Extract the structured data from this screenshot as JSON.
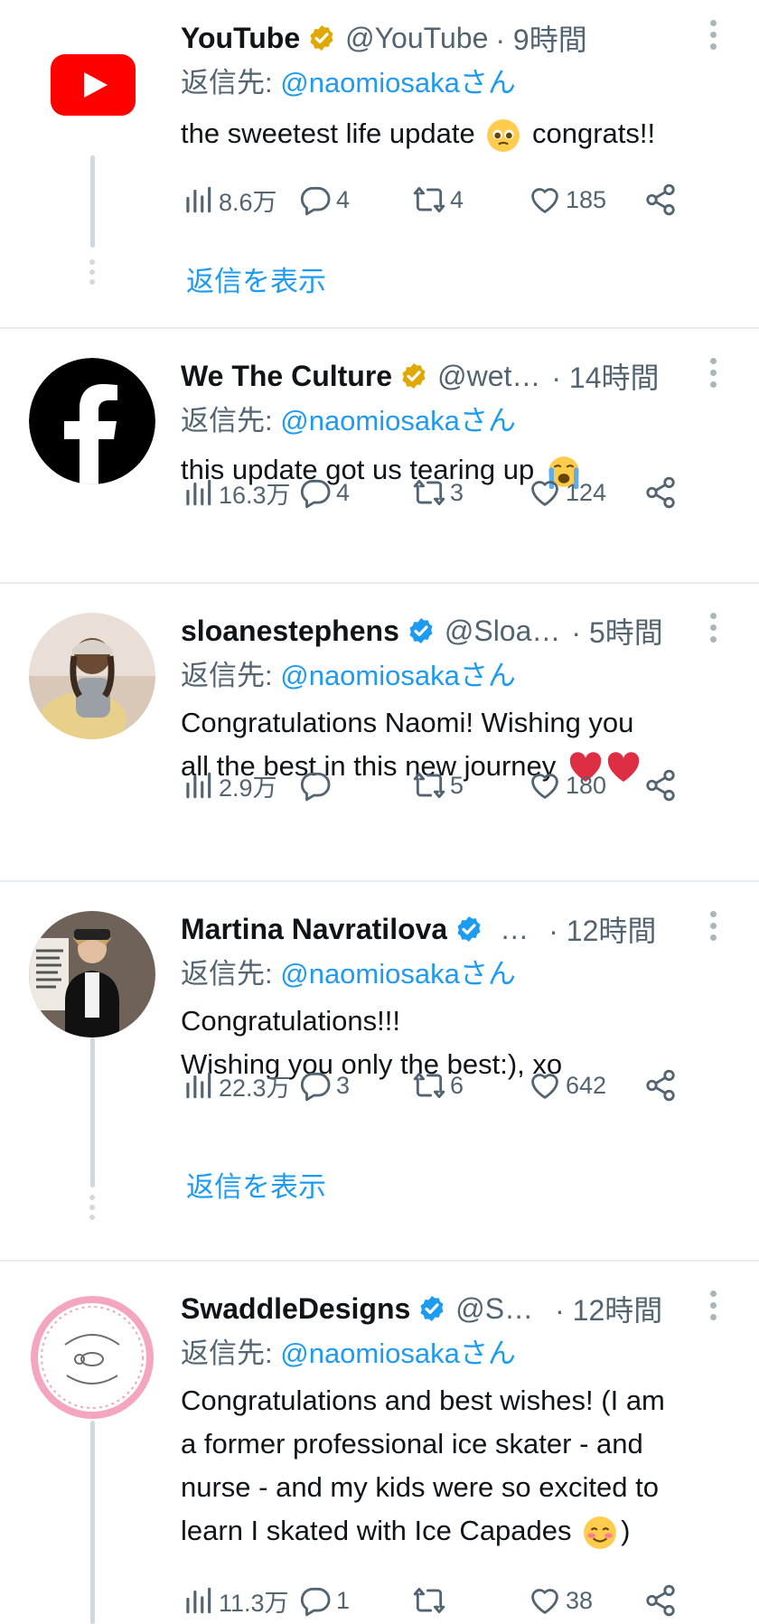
{
  "strings": {
    "reply_prefix": "返信先: ",
    "show_replies": "返信を表示"
  },
  "colors": {
    "accent": "#1d9bf0",
    "secondary_text": "#536471",
    "gold_badge": "#e0a800",
    "blue_badge": "#1d9bf0",
    "divider": "#e6ecf0"
  },
  "tweets": [
    {
      "name": "YouTube",
      "badge": "gold-verified-badge",
      "handle": "@YouTube",
      "time": "· 9時間",
      "reply_to": "@naomiosakaさん",
      "text": "the sweetest life update",
      "text_after": "congrats!!",
      "emoji": "pleading-face-emoji",
      "views": "8.6万",
      "replies": "4",
      "retweets": "4",
      "likes": "185",
      "show_replies": true
    },
    {
      "name": "We The Culture",
      "badge": "gold-verified-badge",
      "handle": "@wet…",
      "time": "· 14時間",
      "reply_to": "@naomiosakaさん",
      "text": "this update got us tearing up",
      "emoji": "loudly-crying-face-emoji",
      "views": "16.3万",
      "replies": "4",
      "retweets": "3",
      "likes": "124",
      "show_replies": false
    },
    {
      "name": "sloanestephens",
      "badge": "blue-verified-badge",
      "handle": "@Sloa…",
      "time": "· 5時間",
      "reply_to": "@naomiosakaさん",
      "text": "Congratulations Naomi! Wishing you\nall the best in this new journey",
      "emoji": "two-red-hearts-emoji",
      "views": "2.9万",
      "replies": "",
      "retweets": "5",
      "likes": "180",
      "show_replies": false
    },
    {
      "name": "Martina Navratilova",
      "badge": "blue-verified-badge",
      "handle": "…",
      "time": "· 12時間",
      "reply_to": "@naomiosakaさん",
      "text": "Congratulations!!!\nWishing you only the best:), xo",
      "views": "22.3万",
      "replies": "3",
      "retweets": "6",
      "likes": "642",
      "show_replies": true
    },
    {
      "name": "SwaddleDesigns",
      "badge": "blue-verified-badge",
      "handle": "@S…",
      "time": "· 12時間",
      "reply_to": "@naomiosakaさん",
      "text": "Congratulations and best wishes! (I am\na former professional ice skater - and\nnurse -  and my kids were so excited to\nlearn I skated with Ice Capades",
      "text_after": ")",
      "emoji": "smiling-face-emoji",
      "views": "11.3万",
      "replies": "1",
      "retweets": "",
      "likes": "38",
      "show_replies": false
    }
  ]
}
